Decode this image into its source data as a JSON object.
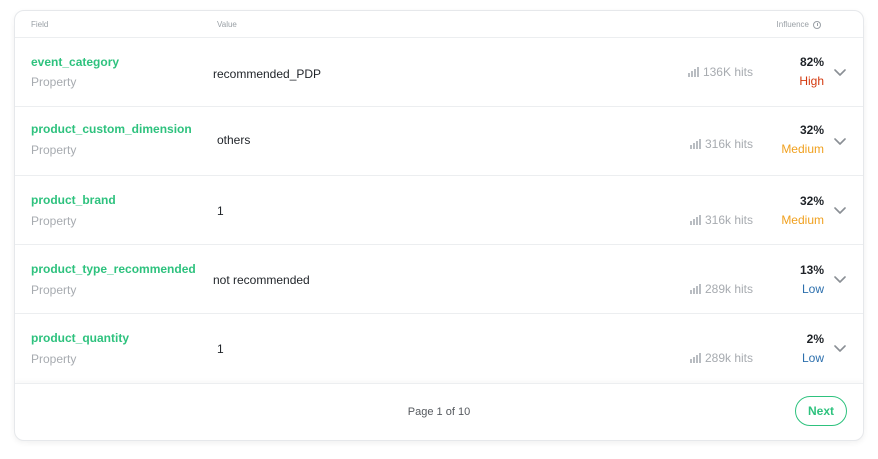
{
  "header": {
    "field_label": "Field",
    "value_label": "Value",
    "influence_label": "Influence"
  },
  "rows": [
    {
      "field": "event_category",
      "type": "Property",
      "value": "recommended_PDP",
      "hits": "136K hits",
      "percent": "82%",
      "level": "High"
    },
    {
      "field": "product_custom_dimension",
      "type": "Property",
      "value": "others",
      "hits": "316k hits",
      "percent": "32%",
      "level": "Medium"
    },
    {
      "field": "product_brand",
      "type": "Property",
      "value": "1",
      "hits": "316k hits",
      "percent": "32%",
      "level": "Medium"
    },
    {
      "field": "product_type_recommended",
      "type": "Property",
      "value": "not recommended",
      "hits": "289k hits",
      "percent": "13%",
      "level": "Low"
    },
    {
      "field": "product_quantity",
      "type": "Property",
      "value": "1",
      "hits": "289k hits",
      "percent": "2%",
      "level": "Low"
    }
  ],
  "footer": {
    "pagination": "Page 1 of 10",
    "next_label": "Next"
  },
  "colors": {
    "accent": "#2ec27e",
    "high": "#d4380d",
    "medium": "#f0a01e",
    "low": "#2c6fad"
  },
  "icons": {
    "info": "info-icon",
    "hits": "bar-chart-icon",
    "expand": "chevron-down-icon"
  }
}
